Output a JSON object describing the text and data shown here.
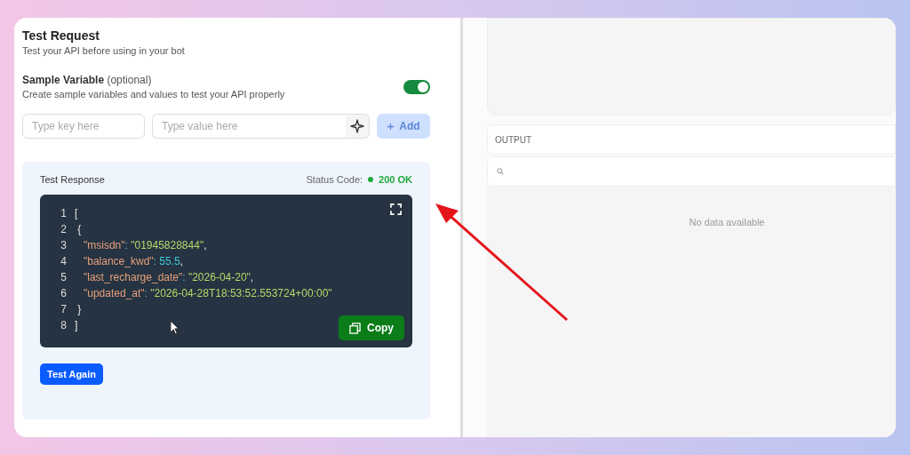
{
  "test_request": {
    "title": "Test Request",
    "subtitle": "Test your API before using in your bot"
  },
  "sample_variable": {
    "label": "Sample Variable",
    "optional": "(optional)",
    "description": "Create sample variables and values to test your API properly",
    "on": true
  },
  "key_field": {
    "placeholder": "Type key here"
  },
  "value_field": {
    "placeholder": "Type value here"
  },
  "add_button": {
    "label": "Add",
    "disabled": true
  },
  "test_response": {
    "title": "Test Response",
    "status_label": "Status Code:",
    "status": "200 OK",
    "color": "#1fa83a",
    "lines": [
      {
        "number": "1",
        "tokens": [
          {
            "kind": "punct",
            "text": "["
          }
        ]
      },
      {
        "number": "2",
        "tokens": [
          {
            "kind": "punct",
            "text": " {"
          }
        ]
      },
      {
        "number": "3",
        "tokens": [
          {
            "kind": "key",
            "text": "   \"msisdn\""
          },
          {
            "kind": "colon",
            "text": ": "
          },
          {
            "kind": "string",
            "text": "\"01945828844\""
          },
          {
            "kind": "punct",
            "text": ","
          }
        ]
      },
      {
        "number": "4",
        "tokens": [
          {
            "kind": "key",
            "text": "   \"balance_kwd\""
          },
          {
            "kind": "colon",
            "text": ": "
          },
          {
            "kind": "number",
            "text": "55.5"
          },
          {
            "kind": "punct",
            "text": ","
          }
        ]
      },
      {
        "number": "5",
        "tokens": [
          {
            "kind": "key",
            "text": "   \"last_recharge_date\""
          },
          {
            "kind": "colon",
            "text": ": "
          },
          {
            "kind": "string",
            "text": "\"2026-04-20\""
          },
          {
            "kind": "punct",
            "text": ","
          }
        ]
      },
      {
        "number": "6",
        "tokens": [
          {
            "kind": "key",
            "text": "   \"updated_at\""
          },
          {
            "kind": "colon",
            "text": ": "
          },
          {
            "kind": "string",
            "text": "\"2026-04-28T18:53:52.553724+00:00\""
          }
        ]
      },
      {
        "number": "7",
        "tokens": [
          {
            "kind": "punct",
            "text": " }"
          }
        ]
      },
      {
        "number": "8",
        "tokens": [
          {
            "kind": "punct",
            "text": "]"
          }
        ]
      }
    ],
    "copy_button": "Copy",
    "test_again_button": "Test Again"
  },
  "output": {
    "title": "OUTPUT",
    "empty_message": "No data available"
  }
}
